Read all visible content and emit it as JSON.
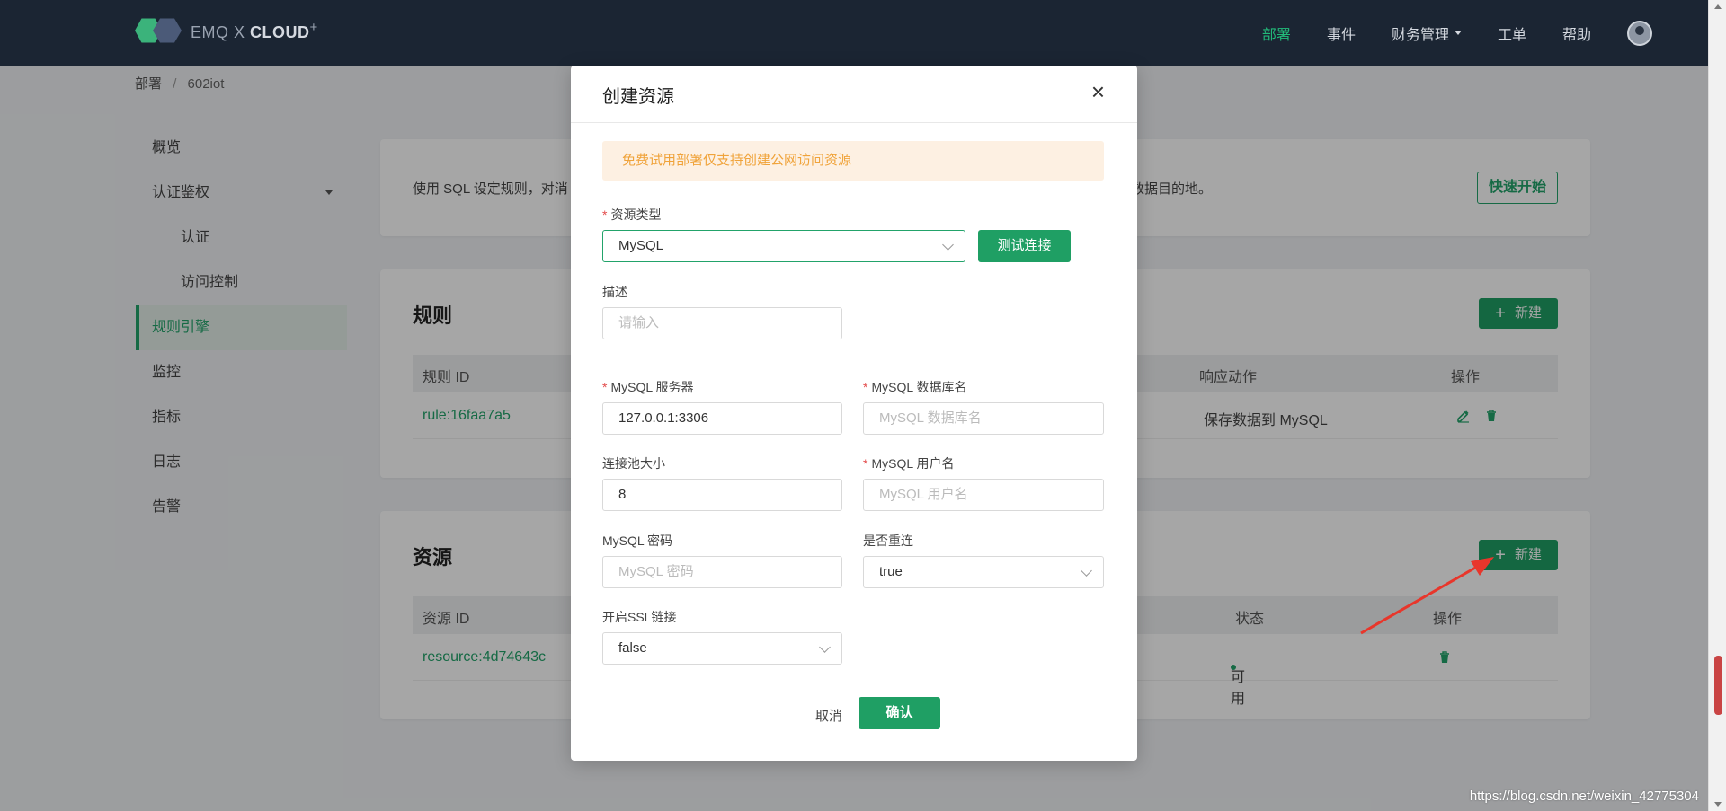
{
  "header": {
    "logo_text_1": "EMQ X",
    "logo_text_2": "CLOUD",
    "nav": [
      "部署",
      "事件",
      "财务管理",
      "工单",
      "帮助"
    ]
  },
  "breadcrumb": {
    "root": "部署",
    "sep": "/",
    "current": "602iot"
  },
  "sidebar": {
    "items": [
      "概览",
      "认证鉴权",
      "认证",
      "访问控制",
      "规则引擎",
      "监控",
      "指标",
      "日志",
      "告警"
    ]
  },
  "intro_card": {
    "text_left": "使用 SQL 设定规则，对消",
    "text_right": "等数据目的地。",
    "quick_start": "快速开始"
  },
  "rules_card": {
    "title": "规则",
    "new_button": "新建",
    "headers": [
      "规则 ID",
      "响应动作",
      "操作"
    ],
    "row": {
      "id": "rule:16faa7a5",
      "action": "保存数据到 MySQL"
    }
  },
  "resources_card": {
    "title": "资源",
    "new_button": "新建",
    "headers": [
      "资源 ID",
      "状态",
      "操作"
    ],
    "row": {
      "id": "resource:4d74643c",
      "status": "可用"
    }
  },
  "modal": {
    "title": "创建资源",
    "close": "×",
    "alert": "免费试用部署仅支持创建公网访问资源",
    "resource_type_label": "资源类型",
    "resource_type_value": "MySQL",
    "test_button": "测试连接",
    "desc_label": "描述",
    "desc_placeholder": "请输入",
    "server_label": "MySQL 服务器",
    "server_value": "127.0.0.1:3306",
    "db_label": "MySQL 数据库名",
    "db_placeholder": "MySQL 数据库名",
    "pool_label": "连接池大小",
    "pool_value": "8",
    "user_label": "MySQL 用户名",
    "user_placeholder": "MySQL 用户名",
    "pwd_label": "MySQL 密码",
    "pwd_placeholder": "MySQL 密码",
    "reconnect_label": "是否重连",
    "reconnect_value": "true",
    "ssl_label": "开启SSL链接",
    "ssl_value": "false",
    "cancel": "取消",
    "confirm": "确认"
  },
  "watermark": "https://blog.csdn.net/weixin_42775304",
  "colors": {
    "accent": "#1f9f64",
    "nav_bg": "#1b2533",
    "alert_text": "#f0a33a"
  }
}
